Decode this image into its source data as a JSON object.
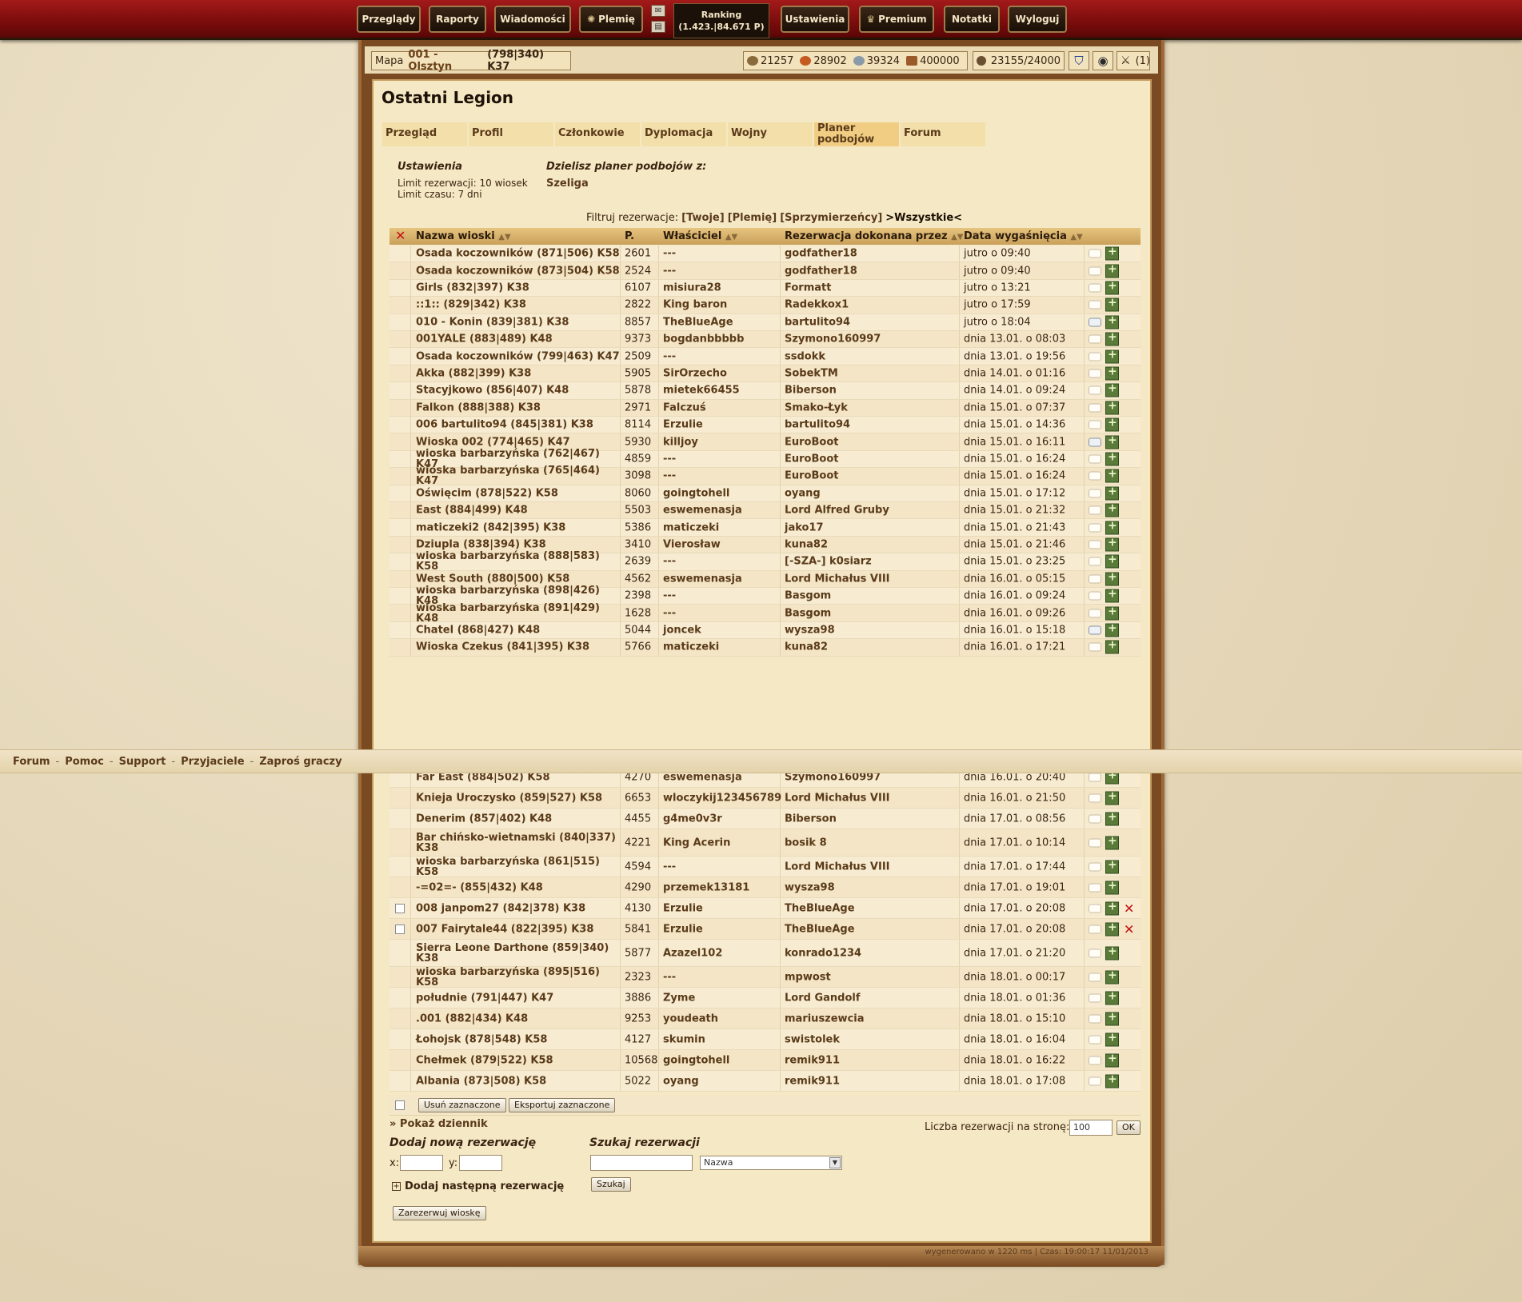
{
  "topnav": {
    "items": [
      {
        "label": "Przeglądy"
      },
      {
        "label": "Raporty"
      },
      {
        "label": "Wiadomości"
      },
      {
        "label": "Plemię"
      }
    ],
    "ranking_label": "Ranking",
    "ranking_value": "(1.423.|84.671 P)",
    "items_right": [
      {
        "label": "Ustawienia"
      },
      {
        "label": "Premium"
      },
      {
        "label": "Notatki"
      },
      {
        "label": "Wyloguj"
      }
    ]
  },
  "infobar": {
    "map_label": "Mapa",
    "village": "001 - Olsztyn",
    "coords": "(798|340) K37",
    "wood": "21257",
    "clay": "28902",
    "iron": "39324",
    "storage": "400000",
    "population": "23155/24000",
    "attacks": "(1)"
  },
  "page": {
    "title": "Ostatni Legion",
    "tabs": [
      "Przegląd",
      "Profil",
      "Członkowie",
      "Dyplomacja",
      "Wojny",
      "Planer podbojów",
      "Forum"
    ],
    "active_tab": "Planer podbojów"
  },
  "settings": {
    "heading": "Ustawienia",
    "limit_reservations": "Limit rezerwacji: 10 wiosek",
    "limit_time": "Limit czasu: 7 dni",
    "share_heading": "Dzielisz planer podbojów z:",
    "share_with": "Szeliga"
  },
  "filter": {
    "label": "Filtruj rezerwacje:",
    "yours": "[Twoje]",
    "tribe": "[Plemię]",
    "allies": "[Sprzymierzeńcy]",
    "all": ">Wszystkie<"
  },
  "table": {
    "headers": {
      "name": "Nazwa wioski",
      "points": "P.",
      "owner": "Właściciel",
      "reserved_by": "Rezerwacja dokonana przez",
      "expires": "Data wygaśnięcia"
    },
    "rows_top": [
      {
        "name": "Osada koczowników (871|506) K58",
        "points": "2601",
        "owner": "---",
        "by": "godfather18",
        "date": "jutro o 09:40"
      },
      {
        "name": "Osada koczowników (873|504) K58",
        "points": "2524",
        "owner": "---",
        "by": "godfather18",
        "date": "jutro o 09:40"
      },
      {
        "name": "Girls (832|397) K38",
        "points": "6107",
        "owner": "misiura28",
        "by": "Formatt",
        "date": "jutro o 13:21"
      },
      {
        "name": "::1:: (829|342) K38",
        "points": "2822",
        "owner": "King baron",
        "by": "Radekkox1",
        "date": "jutro o 17:59"
      },
      {
        "name": "010 - Konin (839|381) K38",
        "points": "8857",
        "owner": "TheBlueAge",
        "by": "bartulito94",
        "date": "jutro o 18:04",
        "msg": true
      },
      {
        "name": "001YALE (883|489) K48",
        "points": "9373",
        "owner": "bogdanbbbbb",
        "by": "Szymono160997",
        "date": "dnia 13.01. o 08:03"
      },
      {
        "name": "Osada koczowników (799|463) K47",
        "points": "2509",
        "owner": "---",
        "by": "ssdokk",
        "date": "dnia 13.01. o 19:56"
      },
      {
        "name": "Akka (882|399) K38",
        "points": "5905",
        "owner": "SirOrzecho",
        "by": "SobekTM",
        "date": "dnia 14.01. o 01:16"
      },
      {
        "name": "Stacyjkowo (856|407) K48",
        "points": "5878",
        "owner": "mietek66455",
        "by": "Biberson",
        "date": "dnia 14.01. o 09:24"
      },
      {
        "name": "Falkon (888|388) K38",
        "points": "2971",
        "owner": "Falczuś",
        "by": "Smako-Łyk",
        "date": "dnia 15.01. o 07:37"
      },
      {
        "name": "006 bartulito94 (845|381) K38",
        "points": "8114",
        "owner": "Erzulie",
        "by": "bartulito94",
        "date": "dnia 15.01. o 14:36"
      },
      {
        "name": "Wioska 002 (774|465) K47",
        "points": "5930",
        "owner": "killjoy",
        "by": "EuroBoot",
        "date": "dnia 15.01. o 16:11",
        "msg": true
      },
      {
        "name": "wioska barbarzyńska (762|467) K47",
        "points": "4859",
        "owner": "---",
        "by": "EuroBoot",
        "date": "dnia 15.01. o 16:24"
      },
      {
        "name": "wioska barbarzyńska (765|464) K47",
        "points": "3098",
        "owner": "---",
        "by": "EuroBoot",
        "date": "dnia 15.01. o 16:24"
      },
      {
        "name": "Oświęcim (878|522) K58",
        "points": "8060",
        "owner": "goingtohell",
        "by": "oyang",
        "date": "dnia 15.01. o 17:12"
      },
      {
        "name": "East (884|499) K48",
        "points": "5503",
        "owner": "eswemenasja",
        "by": "Lord Alfred Gruby",
        "date": "dnia 15.01. o 21:32"
      },
      {
        "name": "maticzeki2 (842|395) K38",
        "points": "5386",
        "owner": "maticzeki",
        "by": "jako17",
        "date": "dnia 15.01. o 21:43"
      },
      {
        "name": "Dziupla (838|394) K38",
        "points": "3410",
        "owner": "Vierosław",
        "by": "kuna82",
        "date": "dnia 15.01. o 21:46"
      },
      {
        "name": "wioska barbarzyńska (888|583) K58",
        "points": "2639",
        "owner": "---",
        "by": "[-SZA-] k0siarz",
        "date": "dnia 15.01. o 23:25"
      },
      {
        "name": "West South (880|500) K58",
        "points": "4562",
        "owner": "eswemenasja",
        "by": "Lord Michałus VIII",
        "date": "dnia 16.01. o 05:15"
      },
      {
        "name": "wioska barbarzyńska (898|426) K48",
        "points": "2398",
        "owner": "---",
        "by": "Basgom",
        "date": "dnia 16.01. o 09:24"
      },
      {
        "name": "wioska barbarzyńska (891|429) K48",
        "points": "1628",
        "owner": "---",
        "by": "Basgom",
        "date": "dnia 16.01. o 09:26"
      },
      {
        "name": "Chatel (868|427) K48",
        "points": "5044",
        "owner": "joncek",
        "by": "wysza98",
        "date": "dnia 16.01. o 15:18",
        "msg": true
      },
      {
        "name": "Wioska Czekus (841|395) K38",
        "points": "5766",
        "owner": "maticzeki",
        "by": "kuna82",
        "date": "dnia 16.01. o 17:21"
      }
    ],
    "rows_bottom": [
      {
        "name": "Far East (884|502) K58",
        "points": "4270",
        "owner": "eswemenasja",
        "by": "Szymono160997",
        "date": "dnia 16.01. o 20:40",
        "h": 26
      },
      {
        "name": "Knieja Uroczysko (859|527) K58",
        "points": "6653",
        "owner": "wloczykij123456789",
        "by": "Lord Michałus VIII",
        "date": "dnia 16.01. o 21:50",
        "h": 26
      },
      {
        "name": "Denerim (857|402) K48",
        "points": "4455",
        "owner": "g4me0v3r",
        "by": "Biberson",
        "date": "dnia 17.01. o 08:56",
        "h": 26
      },
      {
        "name": "Bar chińsko-wietnamski (840|337) K38",
        "points": "4221",
        "owner": "King Acerin",
        "by": "bosik 8",
        "date": "dnia 17.01. o 10:14",
        "h": 34
      },
      {
        "name": "wioska barbarzyńska (861|515) K58",
        "points": "4594",
        "owner": "---",
        "by": "Lord Michałus VIII",
        "date": "dnia 17.01. o 17:44",
        "h": 26
      },
      {
        "name": "-=02=- (855|432) K48",
        "points": "4290",
        "owner": "przemek13181",
        "by": "wysza98",
        "date": "dnia 17.01. o 19:01",
        "h": 26
      },
      {
        "name": "008 janpom27 (842|378) K38",
        "points": "4130",
        "owner": "Erzulie",
        "by": "TheBlueAge",
        "date": "dnia 17.01. o 20:08",
        "h": 26,
        "chk": true,
        "del": true
      },
      {
        "name": "007 Fairytale44 (822|395) K38",
        "points": "5841",
        "owner": "Erzulie",
        "by": "TheBlueAge",
        "date": "dnia 17.01. o 20:08",
        "h": 26,
        "chk": true,
        "del": true
      },
      {
        "name": "Sierra Leone Darthone (859|340) K38",
        "points": "5877",
        "owner": "Azazel102",
        "by": "konrado1234",
        "date": "dnia 17.01. o 21:20",
        "h": 34
      },
      {
        "name": "wioska barbarzyńska (895|516) K58",
        "points": "2323",
        "owner": "---",
        "by": "mpwost",
        "date": "dnia 18.01. o 00:17",
        "h": 26
      },
      {
        "name": "południe (791|447) K47",
        "points": "3886",
        "owner": "Zyme",
        "by": "Lord Gandolf",
        "date": "dnia 18.01. o 01:36",
        "h": 26
      },
      {
        "name": ".001 (882|434) K48",
        "points": "9253",
        "owner": "youdeath",
        "by": "mariuszewcia",
        "date": "dnia 18.01. o 15:10",
        "h": 26
      },
      {
        "name": "Łohojsk (878|548) K58",
        "points": "4127",
        "owner": "skumin",
        "by": "swistolek",
        "date": "dnia 18.01. o 16:04",
        "h": 26
      },
      {
        "name": "Chełmek (879|522) K58",
        "points": "10568",
        "owner": "goingtohell",
        "by": "remik911",
        "date": "dnia 18.01. o 16:22",
        "h": 26
      },
      {
        "name": "Albania (873|508) K58",
        "points": "5022",
        "owner": "oyang",
        "by": "remik911",
        "date": "dnia 18.01. o 17:08",
        "h": 26
      }
    ]
  },
  "actions": {
    "delete_selected": "Usuń zaznaczone",
    "export_selected": "Eksportuj zaznaczone",
    "show_log": "» Pokaż dziennik",
    "per_page_label": "Liczba rezerwacji na stronę:",
    "per_page_value": "100",
    "ok": "OK"
  },
  "new_reservation": {
    "heading": "Dodaj nową rezerwację",
    "x_label": "x:",
    "y_label": "y:",
    "add_next": "Dodaj następną rezerwację",
    "reserve_button": "Zarezerwuj wioskę"
  },
  "search": {
    "heading": "Szukaj rezerwacji",
    "select_value": "Nazwa",
    "button": "Szukaj"
  },
  "footer": {
    "links": [
      "Forum",
      "Pomoc",
      "Support",
      "Przyjaciele",
      "Zaproś graczy"
    ]
  },
  "generated": "wygenerowano w 1220 ms | Czas: 19:00:17 11/01/2013"
}
